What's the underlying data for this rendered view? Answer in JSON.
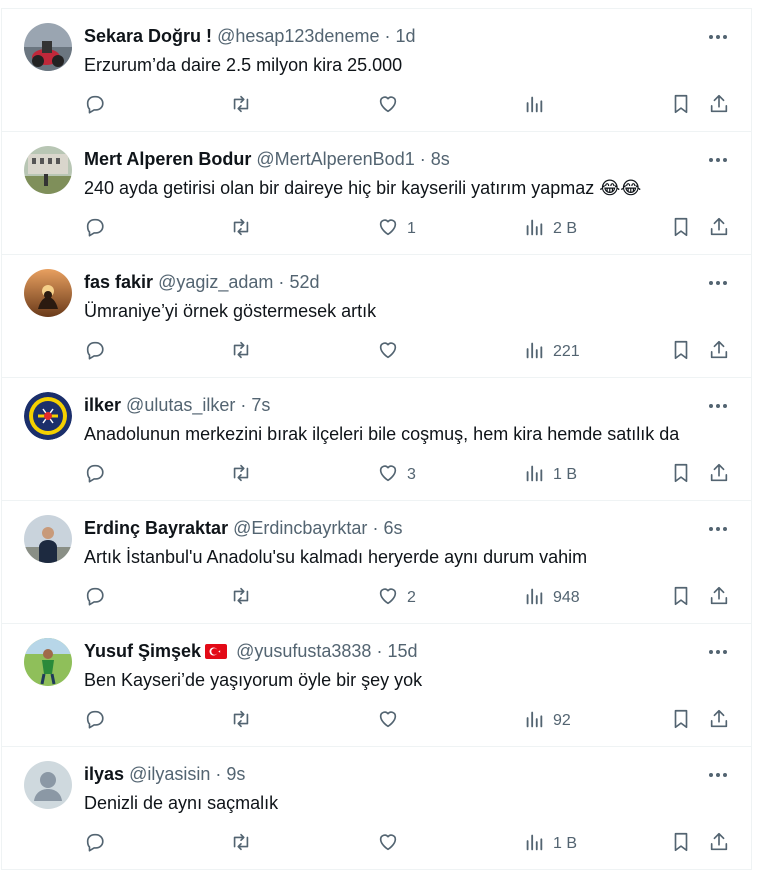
{
  "colors": {
    "text": "#0f1419",
    "secondary": "#536471",
    "divider": "#eff3f4"
  },
  "tweets": [
    {
      "name": "Sekara Doğru !",
      "handle": "@hesap123deneme",
      "sep": "·",
      "time": "1d",
      "text": "Erzurum’da daire 2.5 milyon kira 25.000",
      "likes": "",
      "views": ""
    },
    {
      "name": "Mert Alperen Bodur",
      "handle": "@MertAlperenBod1",
      "sep": "·",
      "time": "8s",
      "text": "240 ayda getirisi olan bir daireye hiç bir kayserili yatırım yapmaz 😂😂",
      "likes": "1",
      "views": "2 B"
    },
    {
      "name": "fas fakir",
      "handle": "@yagiz_adam",
      "sep": "·",
      "time": "52d",
      "text": "Ümraniye’yi örnek göstermesek artık",
      "likes": "",
      "views": "221"
    },
    {
      "name": "ilker",
      "handle": "@ulutas_ilker",
      "sep": "·",
      "time": "7s",
      "text": "Anadolunun merkezini bırak ilçeleri bile coşmuş, hem kira hemde satılık da",
      "likes": "3",
      "views": "1 B"
    },
    {
      "name": "Erdinç Bayraktar",
      "handle": "@Erdincbayrktar",
      "sep": "·",
      "time": "6s",
      "text": "Artık İstanbul'u Anadolu'su kalmadı heryerde aynı durum vahim",
      "likes": "2",
      "views": "948"
    },
    {
      "name": "Yusuf Şimşek",
      "handle": "@yusufusta3838",
      "sep": "·",
      "time": "15d",
      "text": "Ben Kayseri’de yaşıyorum öyle bir şey yok",
      "likes": "",
      "views": "92"
    },
    {
      "name": "ilyas",
      "handle": "@ilyasisin",
      "sep": "·",
      "time": "9s",
      "text": "Denizli de aynı saçmalık",
      "likes": "",
      "views": "1 B"
    }
  ]
}
